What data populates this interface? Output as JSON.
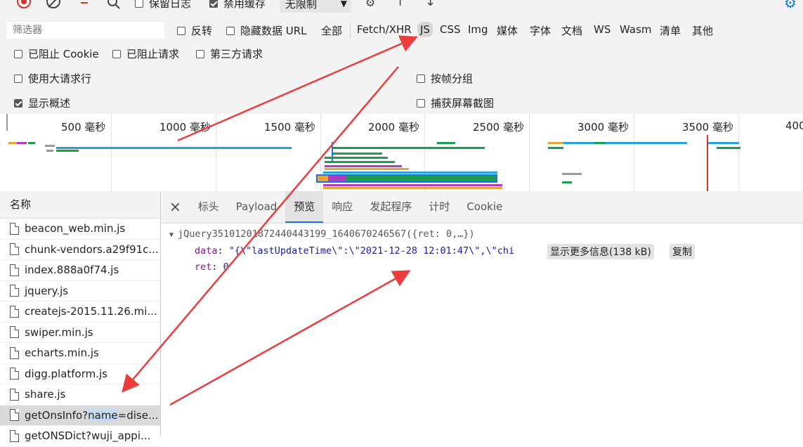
{
  "toolbar": {
    "preserve_log": "保留日志",
    "disable_cache": "禁用缓存",
    "throttle": "无限制"
  },
  "filter": {
    "placeholder": "筛选器",
    "invert": "反转",
    "hide_data_url": "隐藏数据 URL",
    "types": [
      "全部",
      "Fetch/XHR",
      "JS",
      "CSS",
      "Img",
      "媒体",
      "字体",
      "文档",
      "WS",
      "Wasm",
      "清单",
      "其他"
    ],
    "active_type": "JS"
  },
  "block": {
    "blocked_cookies": "已阻止 Cookie",
    "blocked_requests": "已阻止请求",
    "third_party": "第三方请求"
  },
  "settings": {
    "large_rows": "使用大请求行",
    "group_by_frame": "按帧分组",
    "show_overview": "显示概述",
    "capture_screenshots": "捕获屏幕截图"
  },
  "timeline": {
    "ticks": [
      "500 毫秒",
      "1000 毫秒",
      "1500 毫秒",
      "2000 毫秒",
      "2500 毫秒",
      "3000 毫秒",
      "3500 毫秒",
      "400"
    ]
  },
  "requests": {
    "header": "名称",
    "files": [
      {
        "name": "beacon_web.min.js",
        "selected": false
      },
      {
        "name": "chunk-vendors.a29f91c...",
        "selected": false
      },
      {
        "name": "index.888a0f74.js",
        "selected": false
      },
      {
        "name": "jquery.js",
        "selected": false
      },
      {
        "name": "createjs-2015.11.26.mi...",
        "selected": false
      },
      {
        "name": "swiper.min.js",
        "selected": false
      },
      {
        "name": "echarts.min.js",
        "selected": false
      },
      {
        "name": "digg.platform.js",
        "selected": false
      },
      {
        "name": "share.js",
        "selected": false
      },
      {
        "name_pre": "getOnsInfo?",
        "name_hl": "name",
        "name_post": "=dise...",
        "selected": true
      },
      {
        "name": "getONSDict?wuji_appi...",
        "selected": false
      }
    ]
  },
  "details": {
    "close": "×",
    "tabs": [
      "标头",
      "Payload",
      "预览",
      "响应",
      "发起程序",
      "计时",
      "Cookie"
    ],
    "active_tab": "预览",
    "preview": {
      "root": "jQuery35101201872440443199_1640670246567({ret: 0,…})",
      "data_key": "data",
      "data_value": "\"{\\\"lastUpdateTime\\\":\\\"2021-12-28 12:01:47\\\",\\\"chi",
      "show_more": "显示更多信息(138 kB)",
      "copy": "复制",
      "ret_key": "ret",
      "ret_value": "0"
    }
  },
  "colors": {
    "annotation_arrow": "#ee3b3b",
    "accent": "#1a73e8"
  }
}
